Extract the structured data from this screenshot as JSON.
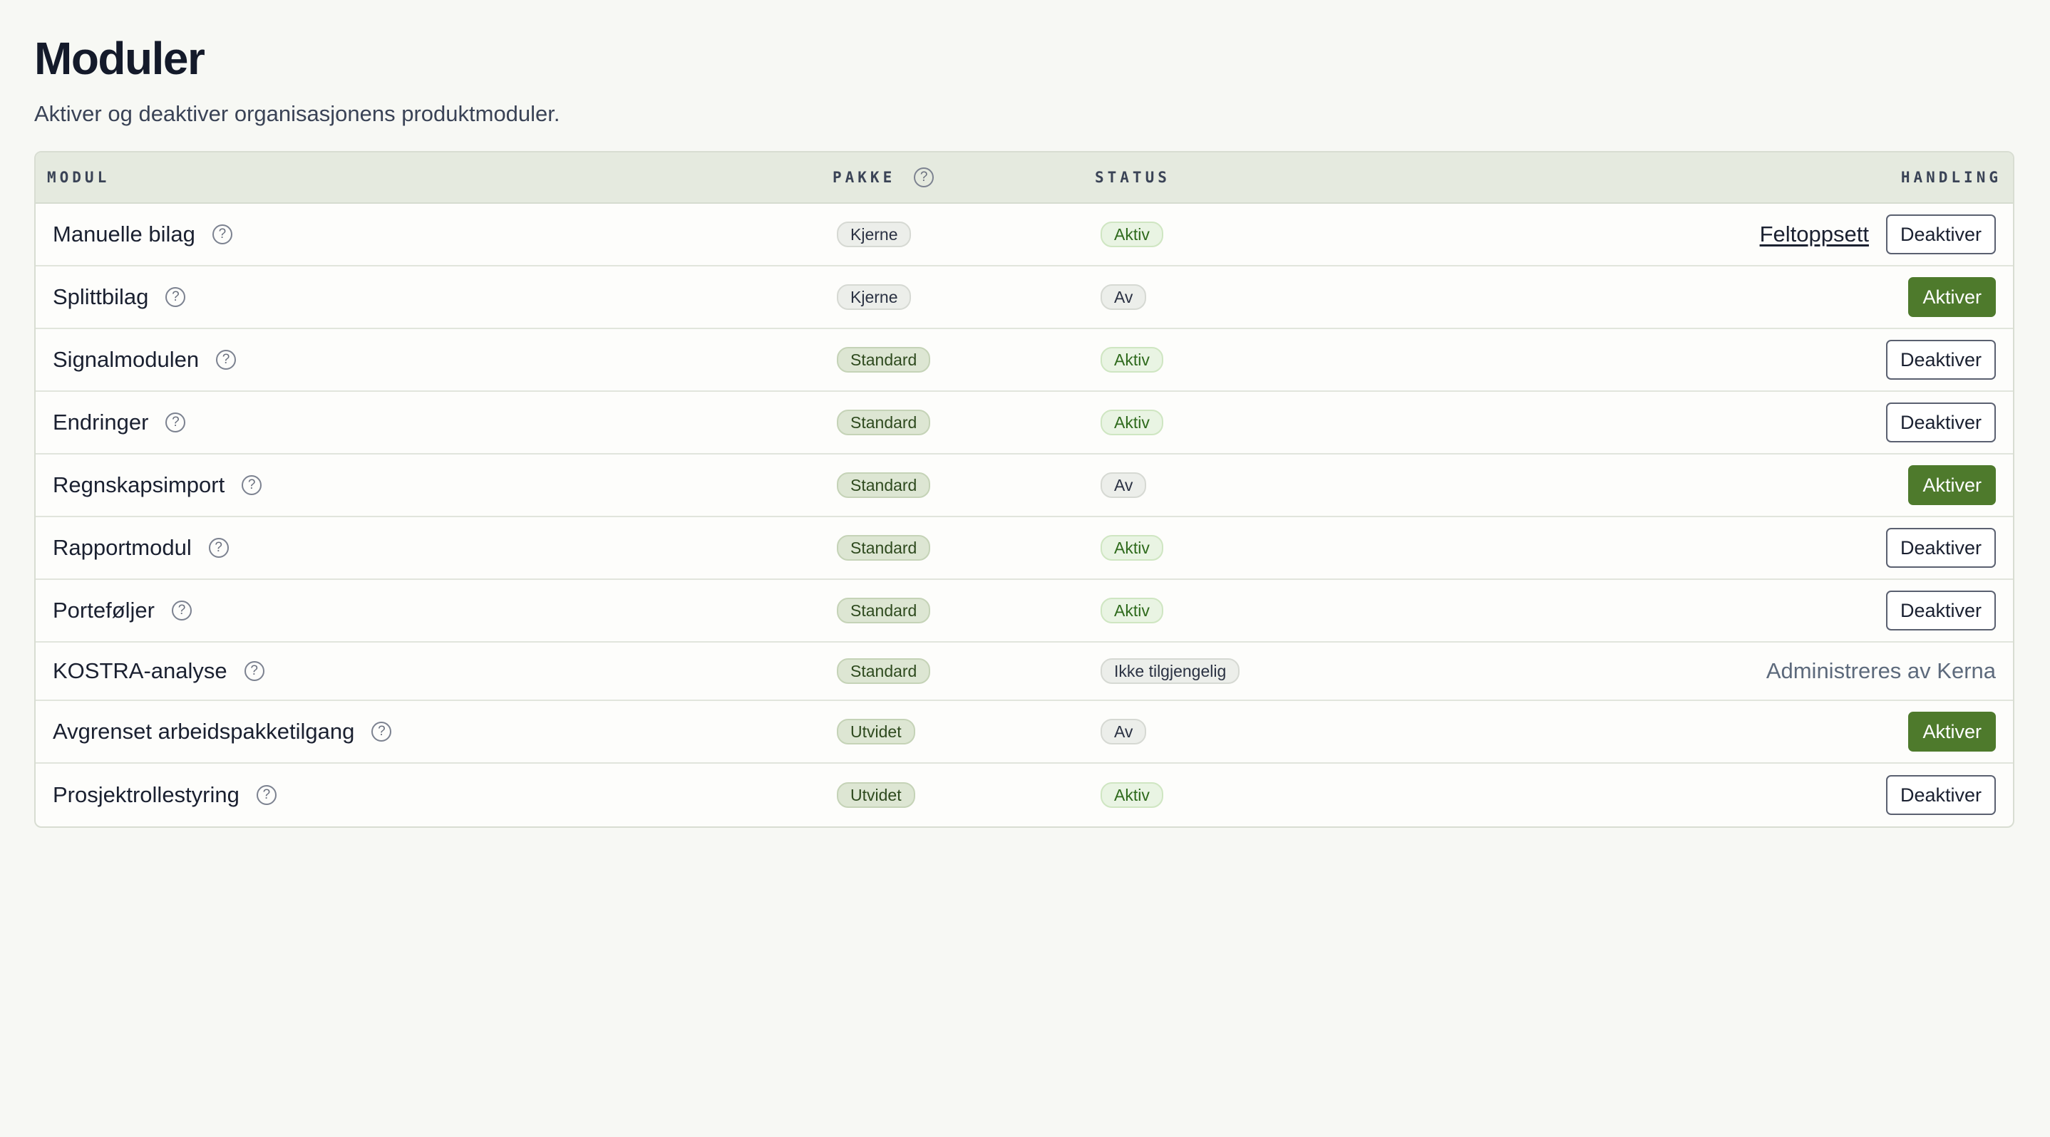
{
  "page": {
    "title": "Moduler",
    "subtitle": "Aktiver og deaktiver organisasjonens produktmoduler."
  },
  "table": {
    "headers": {
      "modul": "MODUL",
      "pakke": "PAKKE",
      "status": "STATUS",
      "handling": "HANDLING"
    },
    "help_glyph": "?",
    "rows": [
      {
        "name": "Manuelle bilag",
        "package": "Kjerne",
        "status": "Aktiv",
        "link": "Feltoppsett",
        "action": "Deaktiver"
      },
      {
        "name": "Splittbilag",
        "package": "Kjerne",
        "status": "Av",
        "action": "Aktiver"
      },
      {
        "name": "Signalmodulen",
        "package": "Standard",
        "status": "Aktiv",
        "action": "Deaktiver"
      },
      {
        "name": "Endringer",
        "package": "Standard",
        "status": "Aktiv",
        "action": "Deaktiver"
      },
      {
        "name": "Regnskapsimport",
        "package": "Standard",
        "status": "Av",
        "action": "Aktiver"
      },
      {
        "name": "Rapportmodul",
        "package": "Standard",
        "status": "Aktiv",
        "action": "Deaktiver"
      },
      {
        "name": "Porteføljer",
        "package": "Standard",
        "status": "Aktiv",
        "action": "Deaktiver"
      },
      {
        "name": "KOSTRA-analyse",
        "package": "Standard",
        "status": "Ikke tilgjengelig",
        "managed_text": "Administreres av Kerna"
      },
      {
        "name": "Avgrenset arbeidspakketilgang",
        "package": "Utvidet",
        "status": "Av",
        "action": "Aktiver"
      },
      {
        "name": "Prosjektrollestyring",
        "package": "Utvidet",
        "status": "Aktiv",
        "action": "Deaktiver"
      }
    ]
  },
  "colors": {
    "accent": "#4e7a2c",
    "background": "#f7f8f4",
    "header_bg": "#e5eadf"
  }
}
